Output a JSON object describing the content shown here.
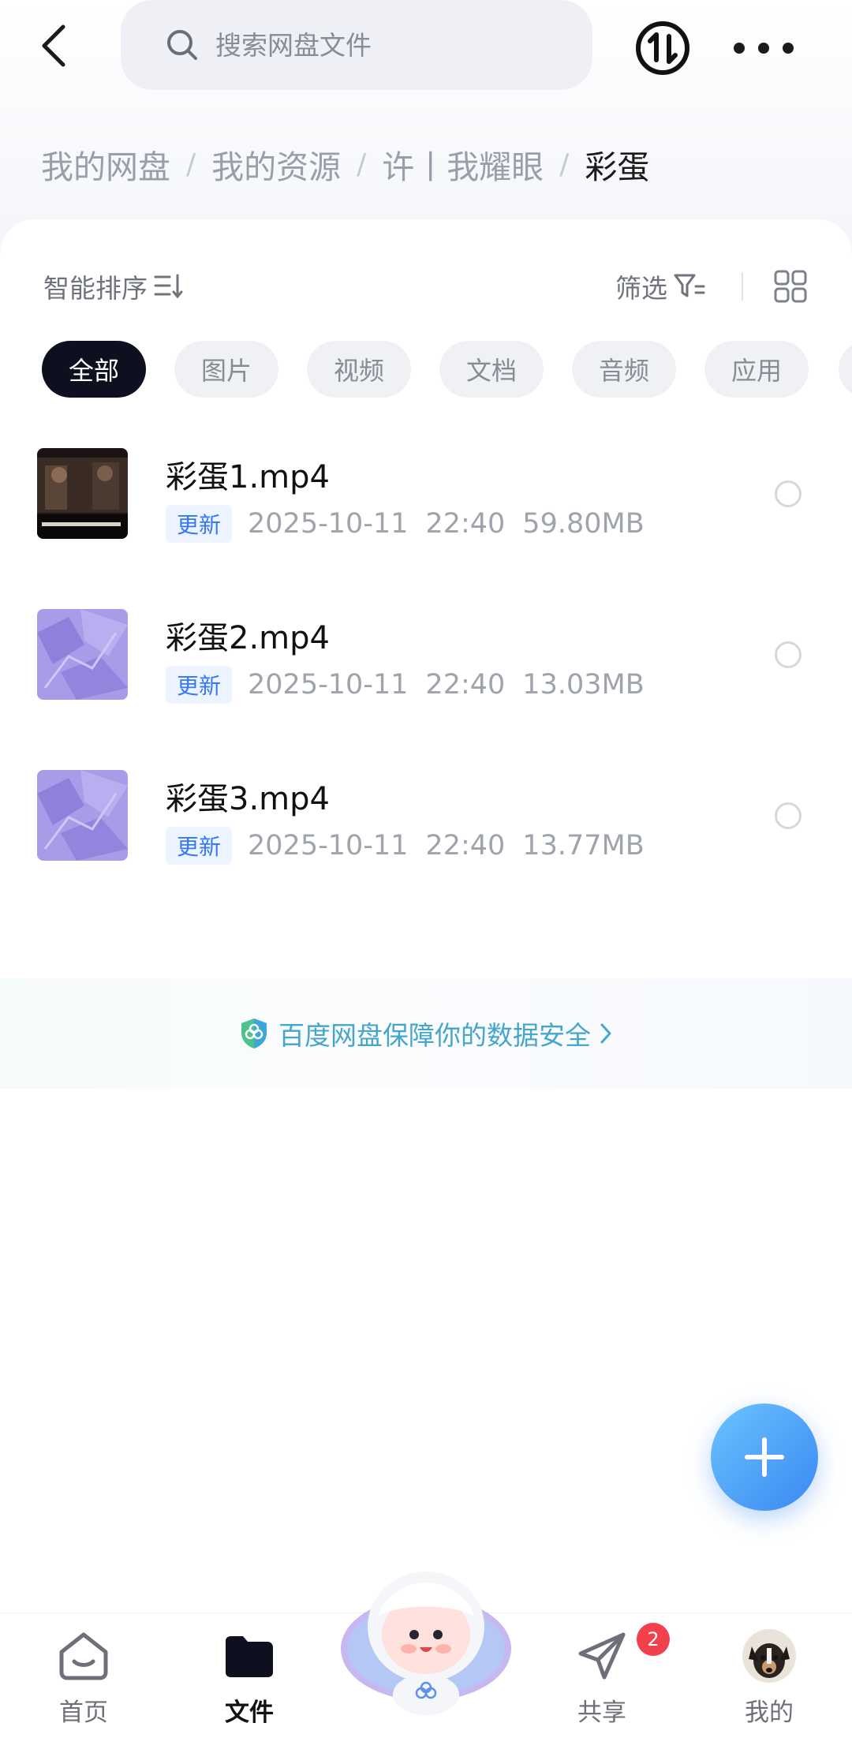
{
  "search": {
    "placeholder": "搜索网盘文件"
  },
  "breadcrumb": {
    "items": [
      "我的网盘",
      "我的资源",
      "许丨我耀眼"
    ],
    "separator": "/",
    "current": "彩蛋"
  },
  "toolbar": {
    "sort_label": "智能排序",
    "filter_label": "筛选"
  },
  "categories": [
    "全部",
    "图片",
    "视频",
    "文档",
    "音频",
    "应用"
  ],
  "active_category": "全部",
  "files": [
    {
      "name": "彩蛋1.mp4",
      "tag": "更新",
      "date": "2025-10-11",
      "time": "22:40",
      "size": "59.80MB",
      "thumb": "video-frame"
    },
    {
      "name": "彩蛋2.mp4",
      "tag": "更新",
      "date": "2025-10-11",
      "time": "22:40",
      "size": "13.03MB",
      "thumb": "purple-abstract"
    },
    {
      "name": "彩蛋3.mp4",
      "tag": "更新",
      "date": "2025-10-11",
      "time": "22:40",
      "size": "13.77MB",
      "thumb": "purple-abstract"
    }
  ],
  "security_banner": {
    "text": "百度网盘保障你的数据安全"
  },
  "nav": {
    "home": "首页",
    "files": "文件",
    "share": "共享",
    "share_badge": "2",
    "me": "我的"
  },
  "colors": {
    "accent": "#3a88f2",
    "chip_active_bg": "#0e1020",
    "tag_text": "#3478f6",
    "badge": "#f2404d"
  }
}
